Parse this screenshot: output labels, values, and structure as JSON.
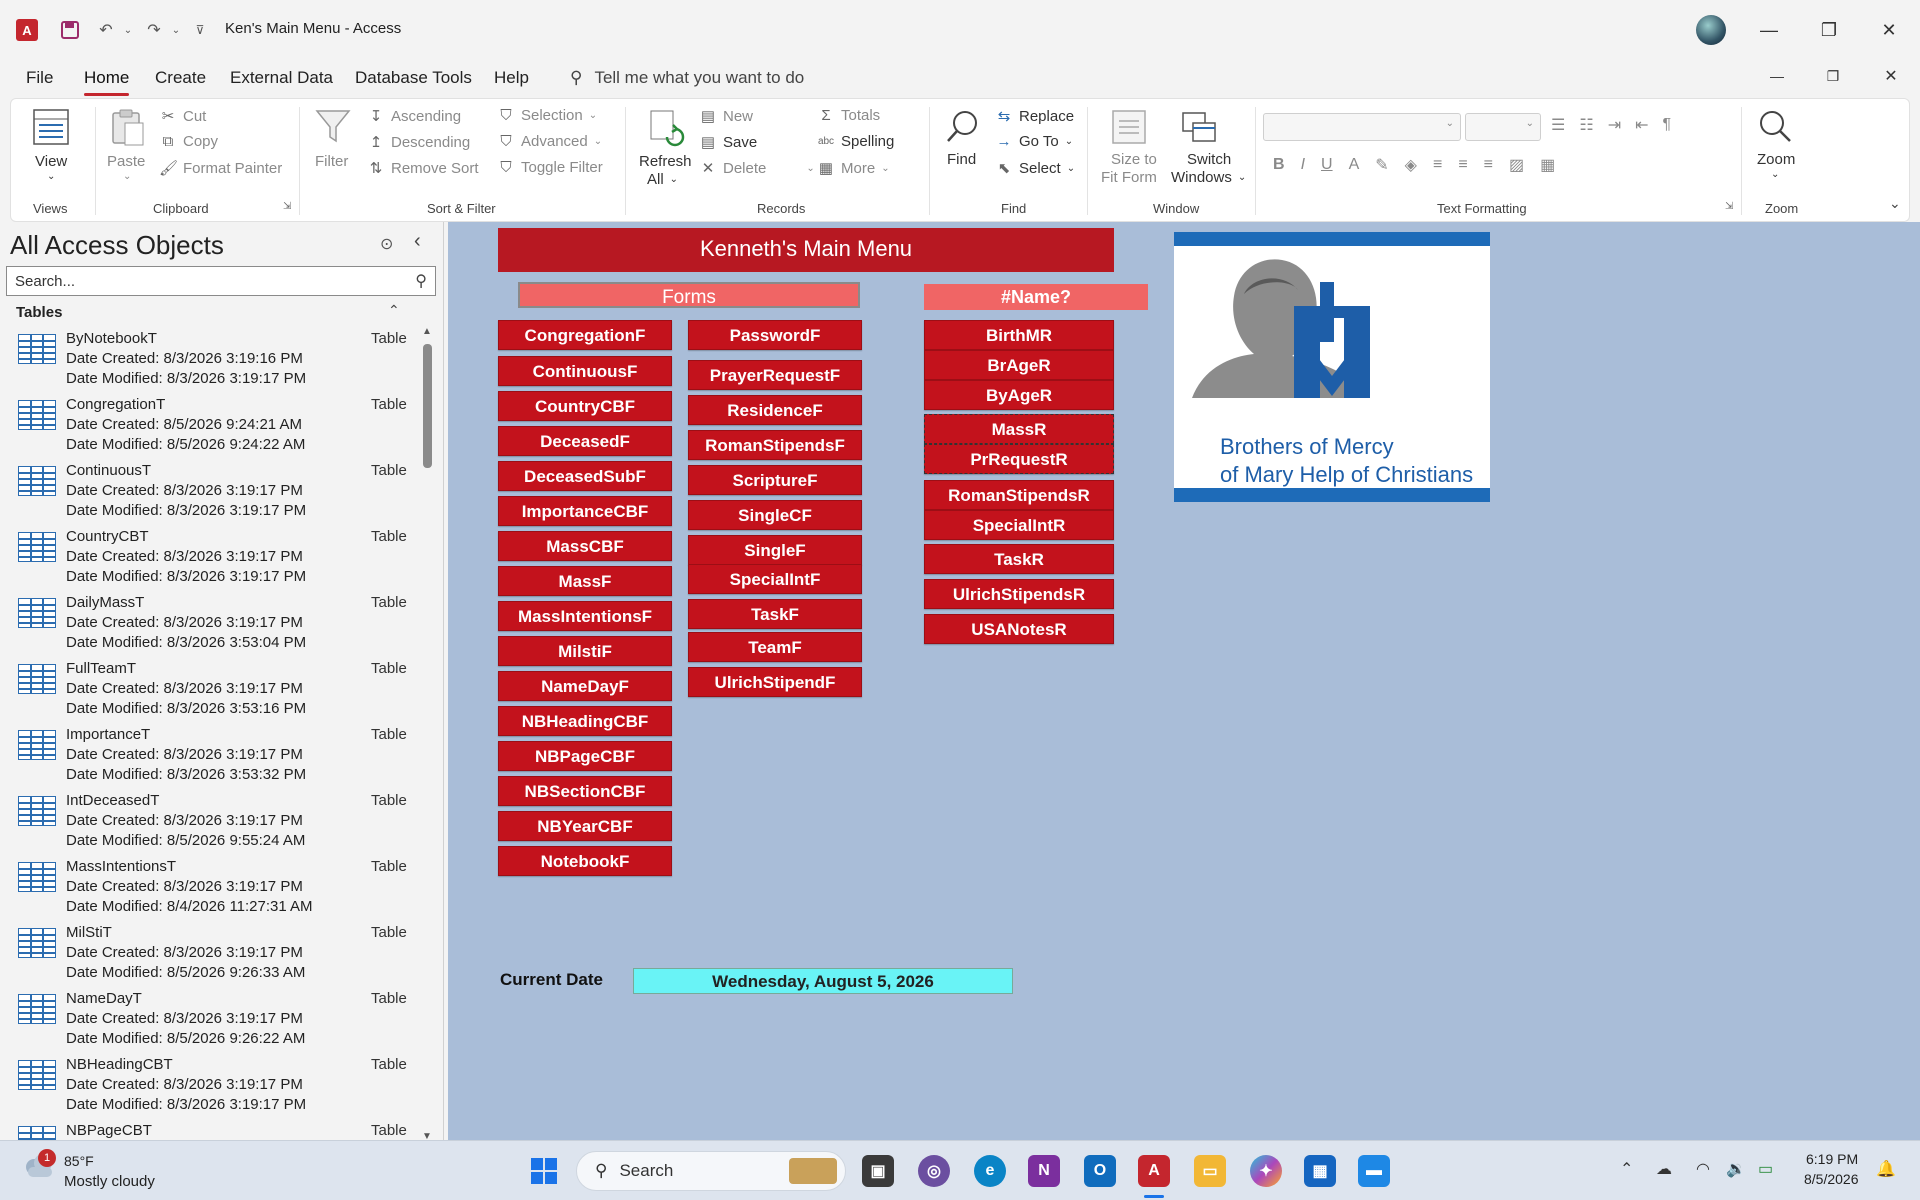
{
  "titlebar": {
    "title": "Ken's Main Menu  -  Access"
  },
  "menu": {
    "tabs": [
      "File",
      "Home",
      "Create",
      "External Data",
      "Database Tools",
      "Help"
    ],
    "active": "Home",
    "tell_me": "Tell me what you want to do"
  },
  "ribbon": {
    "views": {
      "view": "View",
      "group": "Views"
    },
    "clipboard": {
      "paste": "Paste",
      "cut": "Cut",
      "copy": "Copy",
      "format_painter": "Format Painter",
      "group": "Clipboard"
    },
    "sort_filter": {
      "filter": "Filter",
      "ascending": "Ascending",
      "descending": "Descending",
      "remove_sort": "Remove Sort",
      "selection": "Selection",
      "advanced": "Advanced",
      "toggle_filter": "Toggle Filter",
      "group": "Sort & Filter"
    },
    "records": {
      "refresh": "Refresh",
      "refresh_all": "All",
      "new": "New",
      "save": "Save",
      "delete": "Delete",
      "totals": "Totals",
      "spelling": "Spelling",
      "more": "More",
      "group": "Records"
    },
    "find": {
      "find": "Find",
      "replace": "Replace",
      "goto": "Go To",
      "select": "Select",
      "group": "Find"
    },
    "window": {
      "size_line1": "Size to",
      "size_line2": "Fit Form",
      "switch_line1": "Switch",
      "switch_line2": "Windows",
      "group": "Window"
    },
    "text_formatting": {
      "group": "Text Formatting"
    },
    "zoom": {
      "zoom": "Zoom",
      "group": "Zoom"
    }
  },
  "nav": {
    "title": "All Access Objects",
    "search_placeholder": "Search...",
    "section": "Tables",
    "items": [
      {
        "name": "ByNotebookT",
        "type": "Table",
        "created": "Date Created: 8/3/2026 3:19:16 PM",
        "modified": "Date Modified: 8/3/2026 3:19:17 PM"
      },
      {
        "name": "CongregationT",
        "type": "Table",
        "created": "Date Created: 8/5/2026 9:24:21 AM",
        "modified": "Date Modified: 8/5/2026 9:24:22 AM"
      },
      {
        "name": "ContinuousT",
        "type": "Table",
        "created": "Date Created: 8/3/2026 3:19:17 PM",
        "modified": "Date Modified: 8/3/2026 3:19:17 PM"
      },
      {
        "name": "CountryCBT",
        "type": "Table",
        "created": "Date Created: 8/3/2026 3:19:17 PM",
        "modified": "Date Modified: 8/3/2026 3:19:17 PM"
      },
      {
        "name": "DailyMassT",
        "type": "Table",
        "created": "Date Created: 8/3/2026 3:19:17 PM",
        "modified": "Date Modified: 8/3/2026 3:53:04 PM"
      },
      {
        "name": "FullTeamT",
        "type": "Table",
        "created": "Date Created: 8/3/2026 3:19:17 PM",
        "modified": "Date Modified: 8/3/2026 3:53:16 PM"
      },
      {
        "name": "ImportanceT",
        "type": "Table",
        "created": "Date Created: 8/3/2026 3:19:17 PM",
        "modified": "Date Modified: 8/3/2026 3:53:32 PM"
      },
      {
        "name": "IntDeceasedT",
        "type": "Table",
        "created": "Date Created: 8/3/2026 3:19:17 PM",
        "modified": "Date Modified: 8/5/2026 9:55:24 AM"
      },
      {
        "name": "MassIntentionsT",
        "type": "Table",
        "created": "Date Created: 8/3/2026 3:19:17 PM",
        "modified": "Date Modified: 8/4/2026 11:27:31 AM"
      },
      {
        "name": "MilStiT",
        "type": "Table",
        "created": "Date Created: 8/3/2026 3:19:17 PM",
        "modified": "Date Modified: 8/5/2026 9:26:33 AM"
      },
      {
        "name": "NameDayT",
        "type": "Table",
        "created": "Date Created: 8/3/2026 3:19:17 PM",
        "modified": "Date Modified: 8/5/2026 9:26:22 AM"
      },
      {
        "name": "NBHeadingCBT",
        "type": "Table",
        "created": "Date Created: 8/3/2026 3:19:17 PM",
        "modified": "Date Modified: 8/3/2026 3:19:17 PM"
      },
      {
        "name": "NBPageCBT",
        "type": "Table",
        "created": "",
        "modified": ""
      }
    ]
  },
  "form": {
    "title": "Kenneth's Main Menu",
    "forms_header": "Forms",
    "reports_header": "#Name?",
    "forms_col1": [
      "CongregationF",
      "ContinuousF",
      "CountryCBF",
      "DeceasedF",
      "DeceasedSubF",
      "ImportanceCBF",
      "MassCBF",
      "MassF",
      "MassIntentionsF",
      "MilstiF",
      "NameDayF",
      "NBHeadingCBF",
      "NBPageCBF",
      "NBSectionCBF",
      "NBYearCBF",
      "NotebookF"
    ],
    "forms_col2": [
      "PasswordF",
      "PrayerRequestF",
      "ResidenceF",
      "RomanStipendsF",
      "ScriptureF",
      "SingleCF",
      "SingleF",
      "SpecialIntF",
      "TaskF",
      "TeamF",
      "UlrichStipendF"
    ],
    "reports": [
      "BirthMR",
      "BrAgeR",
      "ByAgeR",
      "MassR",
      "PrRequestR",
      "RomanStipendsR",
      "SpecialIntR",
      "TaskR",
      "UlrichStipendsR",
      "USANotesR"
    ],
    "logo_line1": "Brothers of Mercy",
    "logo_line2": "of Mary Help of Christians",
    "date_label": "Current Date",
    "date_value": "Wednesday, August 5, 2026"
  },
  "taskbar": {
    "weather_temp": "85°F",
    "weather_desc": "Mostly cloudy",
    "weather_badge": "1",
    "search": "Search",
    "time": "6:19 PM",
    "date": "8/5/2026"
  }
}
